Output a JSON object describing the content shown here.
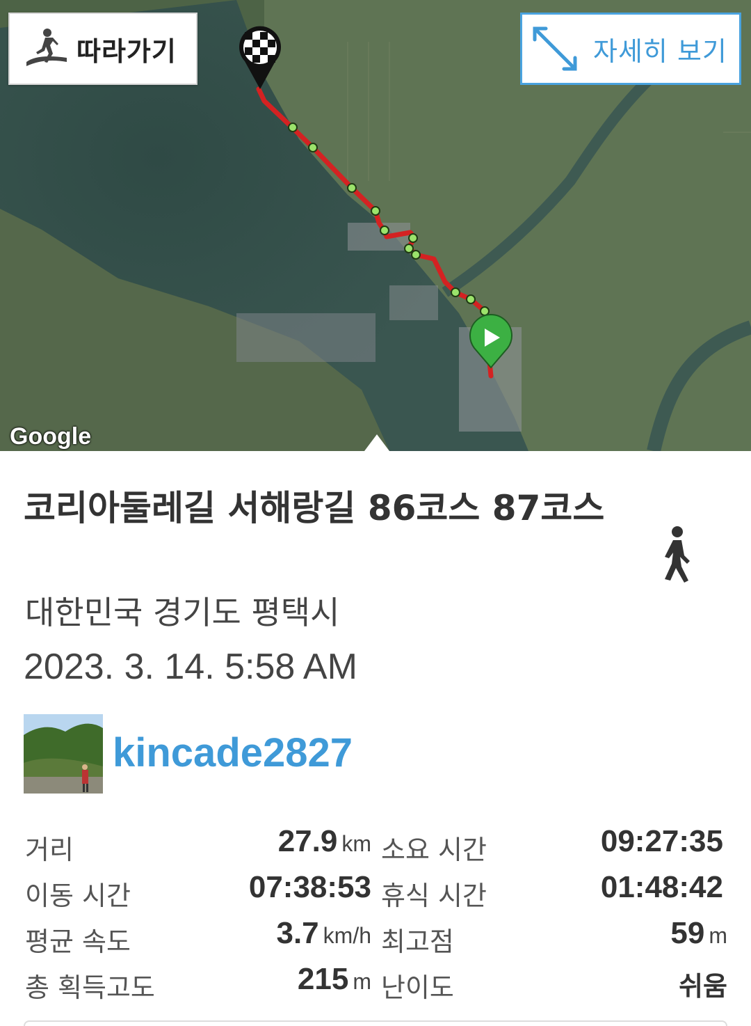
{
  "map": {
    "follow_button_label": "따라가기",
    "detail_button_label": "자세히 보기",
    "attribution": "Google",
    "finish_marker_icon": "checkered-flag-icon",
    "start_marker_icon": "play-icon",
    "colors": {
      "track": "#d42222",
      "waypoint": "#9be36b",
      "start_marker": "#3cb043"
    }
  },
  "trail": {
    "title": "코리아둘레길 서해랑길 86코스 87코스",
    "location": "대한민국 경기도 평택시",
    "datetime": "2023. 3. 14. 5:58 AM",
    "activity_icon": "walking-person-icon",
    "user": {
      "name": "kincade2827"
    }
  },
  "stats": {
    "distance_label": "거리",
    "distance_value": "27.9",
    "distance_unit": "km",
    "total_time_label": "소요 시간",
    "total_time_value": "09:27:35",
    "moving_time_label": "이동 시간",
    "moving_time_value": "07:38:53",
    "rest_time_label": "휴식 시간",
    "rest_time_value": "01:48:42",
    "avg_speed_label": "평균 속도",
    "avg_speed_value": "3.7",
    "avg_speed_unit": "km/h",
    "max_elev_label": "최고점",
    "max_elev_value": "59",
    "max_elev_unit": "m",
    "elev_gain_label": "총 획득고도",
    "elev_gain_value": "215",
    "elev_gain_unit": "m",
    "difficulty_label": "난이도",
    "difficulty_value": "쉬움"
  }
}
